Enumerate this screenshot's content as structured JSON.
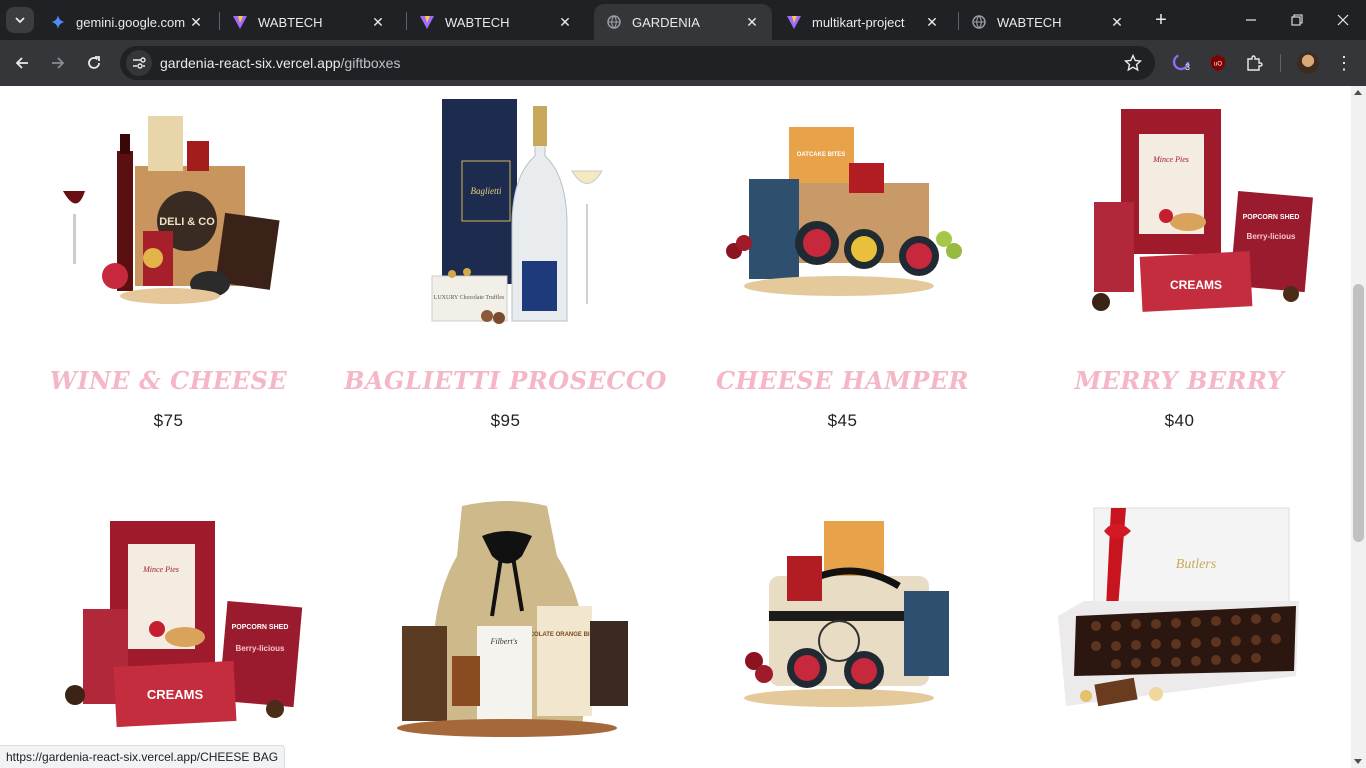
{
  "browser": {
    "tabs": [
      {
        "title": "gemini.google.com",
        "icon": "gemini-icon",
        "active": false
      },
      {
        "title": "WABTECH",
        "icon": "vite-icon",
        "active": false
      },
      {
        "title": "WABTECH",
        "icon": "vite-icon",
        "active": false
      },
      {
        "title": "GARDENIA",
        "icon": "globe-icon",
        "active": true
      },
      {
        "title": "multikart-project",
        "icon": "vite-icon",
        "active": false
      },
      {
        "title": "WABTECH",
        "icon": "globe-icon",
        "active": false
      }
    ],
    "url_host": "gardenia-react-six.vercel.app",
    "url_path": "/giftboxes",
    "extension_badge": "3",
    "status_url": "https://gardenia-react-six.vercel.app/CHEESE BAG"
  },
  "products": [
    {
      "name": "WINE & CHEESE",
      "price": "$75"
    },
    {
      "name": "BAGLIETTI PROSECCO",
      "price": "$95"
    },
    {
      "name": "CHEESE HAMPER",
      "price": "$45"
    },
    {
      "name": "MERRY BERRY",
      "price": "$40"
    },
    {
      "name": "",
      "price": ""
    },
    {
      "name": "",
      "price": ""
    },
    {
      "name": "",
      "price": ""
    },
    {
      "name": "",
      "price": ""
    }
  ],
  "image_labels": {
    "deli": "DELI & CO",
    "baglietti": "Baglietti",
    "luxury": "LUXURY Chocolate Truffles",
    "oatcake": "OATCAKE BITES",
    "mince": "Mince Pies",
    "popcorn": "POPCORN SHED",
    "berry": "Berry-licious",
    "creams": "CREAMS",
    "biscuits": "CHOCOLATE ORANGE BISCUITS",
    "filberts": "Filbert's",
    "butlers": "Butlers"
  },
  "colors": {
    "product_name": "#f5b7c5",
    "chrome_dark": "#202124",
    "chrome_mid": "#35363a"
  }
}
